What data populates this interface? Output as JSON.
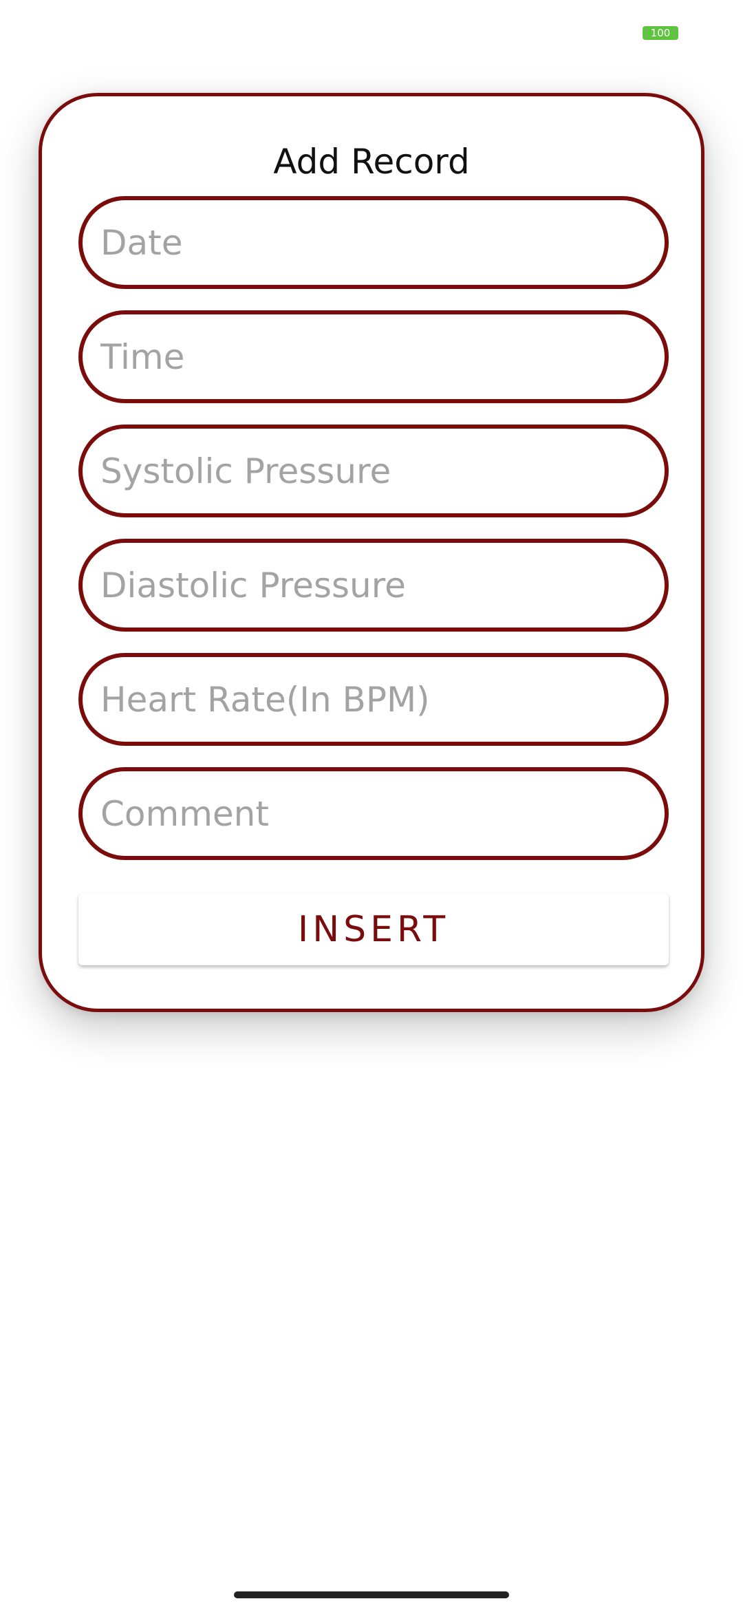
{
  "status_bar": {
    "battery_level": "100",
    "battery_color": "#5fc33f"
  },
  "theme": {
    "accent": "#7a0c0c",
    "placeholder": "#a3a3a3"
  },
  "card": {
    "title": "Add Record",
    "fields": [
      {
        "placeholder": "Date",
        "value": ""
      },
      {
        "placeholder": "Time",
        "value": ""
      },
      {
        "placeholder": "Systolic Pressure",
        "value": ""
      },
      {
        "placeholder": "Diastolic Pressure",
        "value": ""
      },
      {
        "placeholder": "Heart Rate(In BPM)",
        "value": ""
      },
      {
        "placeholder": "Comment",
        "value": ""
      }
    ],
    "insert_label": "INSERT"
  }
}
